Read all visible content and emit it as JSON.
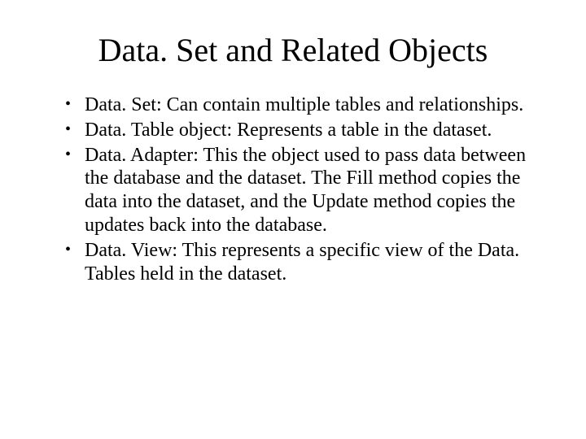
{
  "slide": {
    "title": "Data. Set and Related Objects",
    "bullets": [
      "Data. Set: Can contain multiple tables and relationships.",
      "Data. Table object: Represents a table in the dataset.",
      "Data. Adapter: This the object used to pass data between the database and the dataset.  The Fill method copies the data into the dataset, and the Update method copies the updates back into the database.",
      "Data. View: This represents a specific view of the Data. Tables held in the dataset."
    ]
  }
}
